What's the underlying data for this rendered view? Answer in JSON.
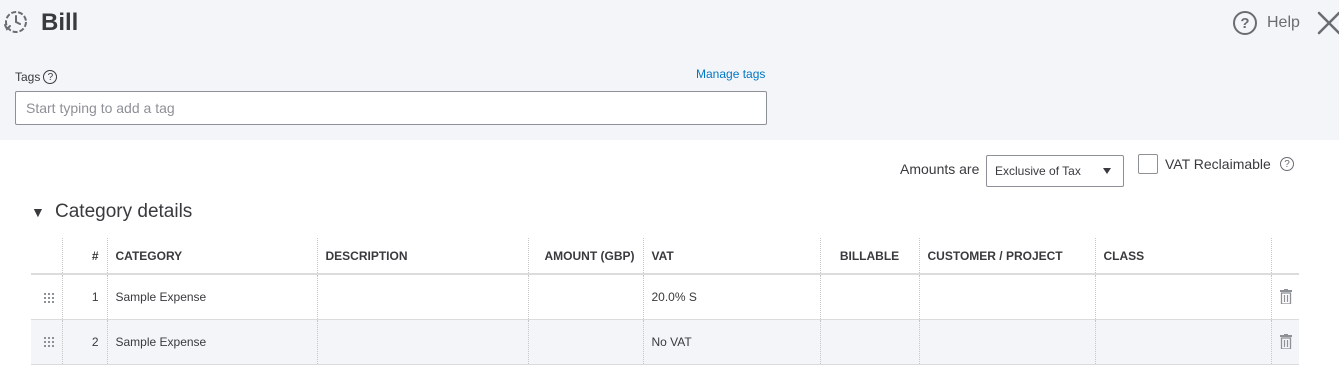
{
  "header": {
    "title": "Bill",
    "help_label": "Help"
  },
  "tags": {
    "label": "Tags",
    "manage_link": "Manage tags",
    "placeholder": "Start typing to add a tag"
  },
  "amounts": {
    "label": "Amounts are",
    "selected": "Exclusive of Tax",
    "vat_reclaimable_label": "VAT Reclaimable"
  },
  "category_section": {
    "title": "Category details",
    "columns": [
      "#",
      "CATEGORY",
      "DESCRIPTION",
      "AMOUNT (GBP)",
      "VAT",
      "BILLABLE",
      "CUSTOMER / PROJECT",
      "CLASS"
    ],
    "rows": [
      {
        "num": "1",
        "category": "Sample Expense",
        "description": "",
        "amount": "",
        "vat": "20.0% S",
        "billable": "",
        "customer": "",
        "class": ""
      },
      {
        "num": "2",
        "category": "Sample Expense",
        "description": "",
        "amount": "",
        "vat": "No VAT",
        "billable": "",
        "customer": "",
        "class": ""
      }
    ]
  },
  "colors": {
    "link": "#0077c5",
    "top_background": "#f4f5f8",
    "text": "#393a3d"
  }
}
